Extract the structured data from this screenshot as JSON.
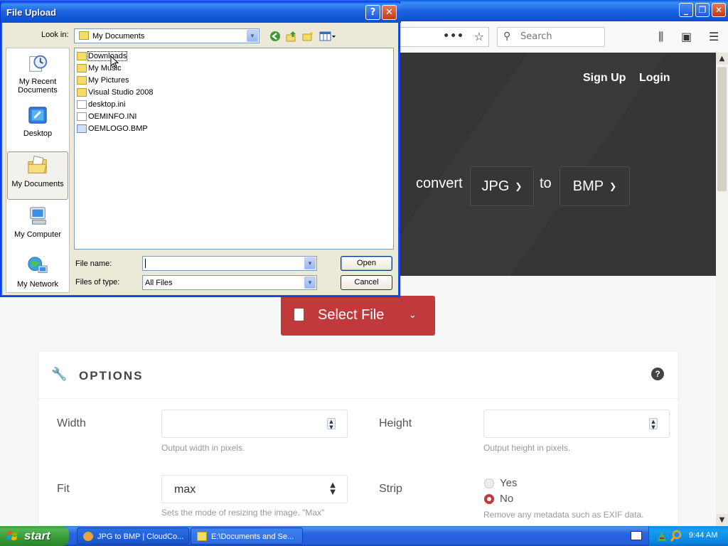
{
  "browser": {
    "search": {
      "placeholder": "Search"
    },
    "menu_dots": "•••"
  },
  "site": {
    "nav": {
      "signup": "Sign Up",
      "login": "Login"
    },
    "convert_label": "convert",
    "from_format": "JPG",
    "to_label": "to",
    "to_format": "BMP",
    "select_file_label": "Select File"
  },
  "options": {
    "title": "OPTIONS",
    "width": {
      "label": "Width",
      "value": "",
      "hint": "Output width in pixels."
    },
    "height": {
      "label": "Height",
      "value": "",
      "hint": "Output height in pixels."
    },
    "fit": {
      "label": "Fit",
      "value": "max",
      "hint": "Sets the mode of resizing the image. \"Max\""
    },
    "strip": {
      "label": "Strip",
      "yes": "Yes",
      "no": "No",
      "selected": "No",
      "hint": "Remove any metadata such as EXIF data."
    }
  },
  "dialog": {
    "title": "File Upload",
    "look_in_label": "Look in:",
    "look_in_value": "My Documents",
    "places": [
      {
        "label": "My Recent Documents",
        "icon": "recent-documents-icon"
      },
      {
        "label": "Desktop",
        "icon": "desktop-icon"
      },
      {
        "label": "My Documents",
        "icon": "my-documents-icon",
        "selected": true
      },
      {
        "label": "My Computer",
        "icon": "my-computer-icon"
      },
      {
        "label": "My Network",
        "icon": "my-network-icon"
      }
    ],
    "files": [
      {
        "name": "Downloads",
        "type": "folder"
      },
      {
        "name": "My Music",
        "type": "folder"
      },
      {
        "name": "My Pictures",
        "type": "folder"
      },
      {
        "name": "Visual Studio 2008",
        "type": "folder"
      },
      {
        "name": "desktop.ini",
        "type": "file"
      },
      {
        "name": "OEMINFO.INI",
        "type": "file"
      },
      {
        "name": "OEMLOGO.BMP",
        "type": "bmp"
      }
    ],
    "file_name_label": "File name:",
    "file_name_value": "",
    "files_of_type_label": "Files of type:",
    "files_of_type_value": "All Files",
    "open_label": "Open",
    "cancel_label": "Cancel"
  },
  "taskbar": {
    "start_label": "start",
    "tasks": [
      {
        "label": "JPG to BMP | CloudCo..."
      },
      {
        "label": "E:\\Documents and Se..."
      }
    ],
    "clock": "9:44 AM"
  },
  "colors": {
    "accent_red": "#c0393b",
    "hero_bg": "#353535",
    "xp_blue": "#245edb",
    "start_green": "#379a37"
  }
}
